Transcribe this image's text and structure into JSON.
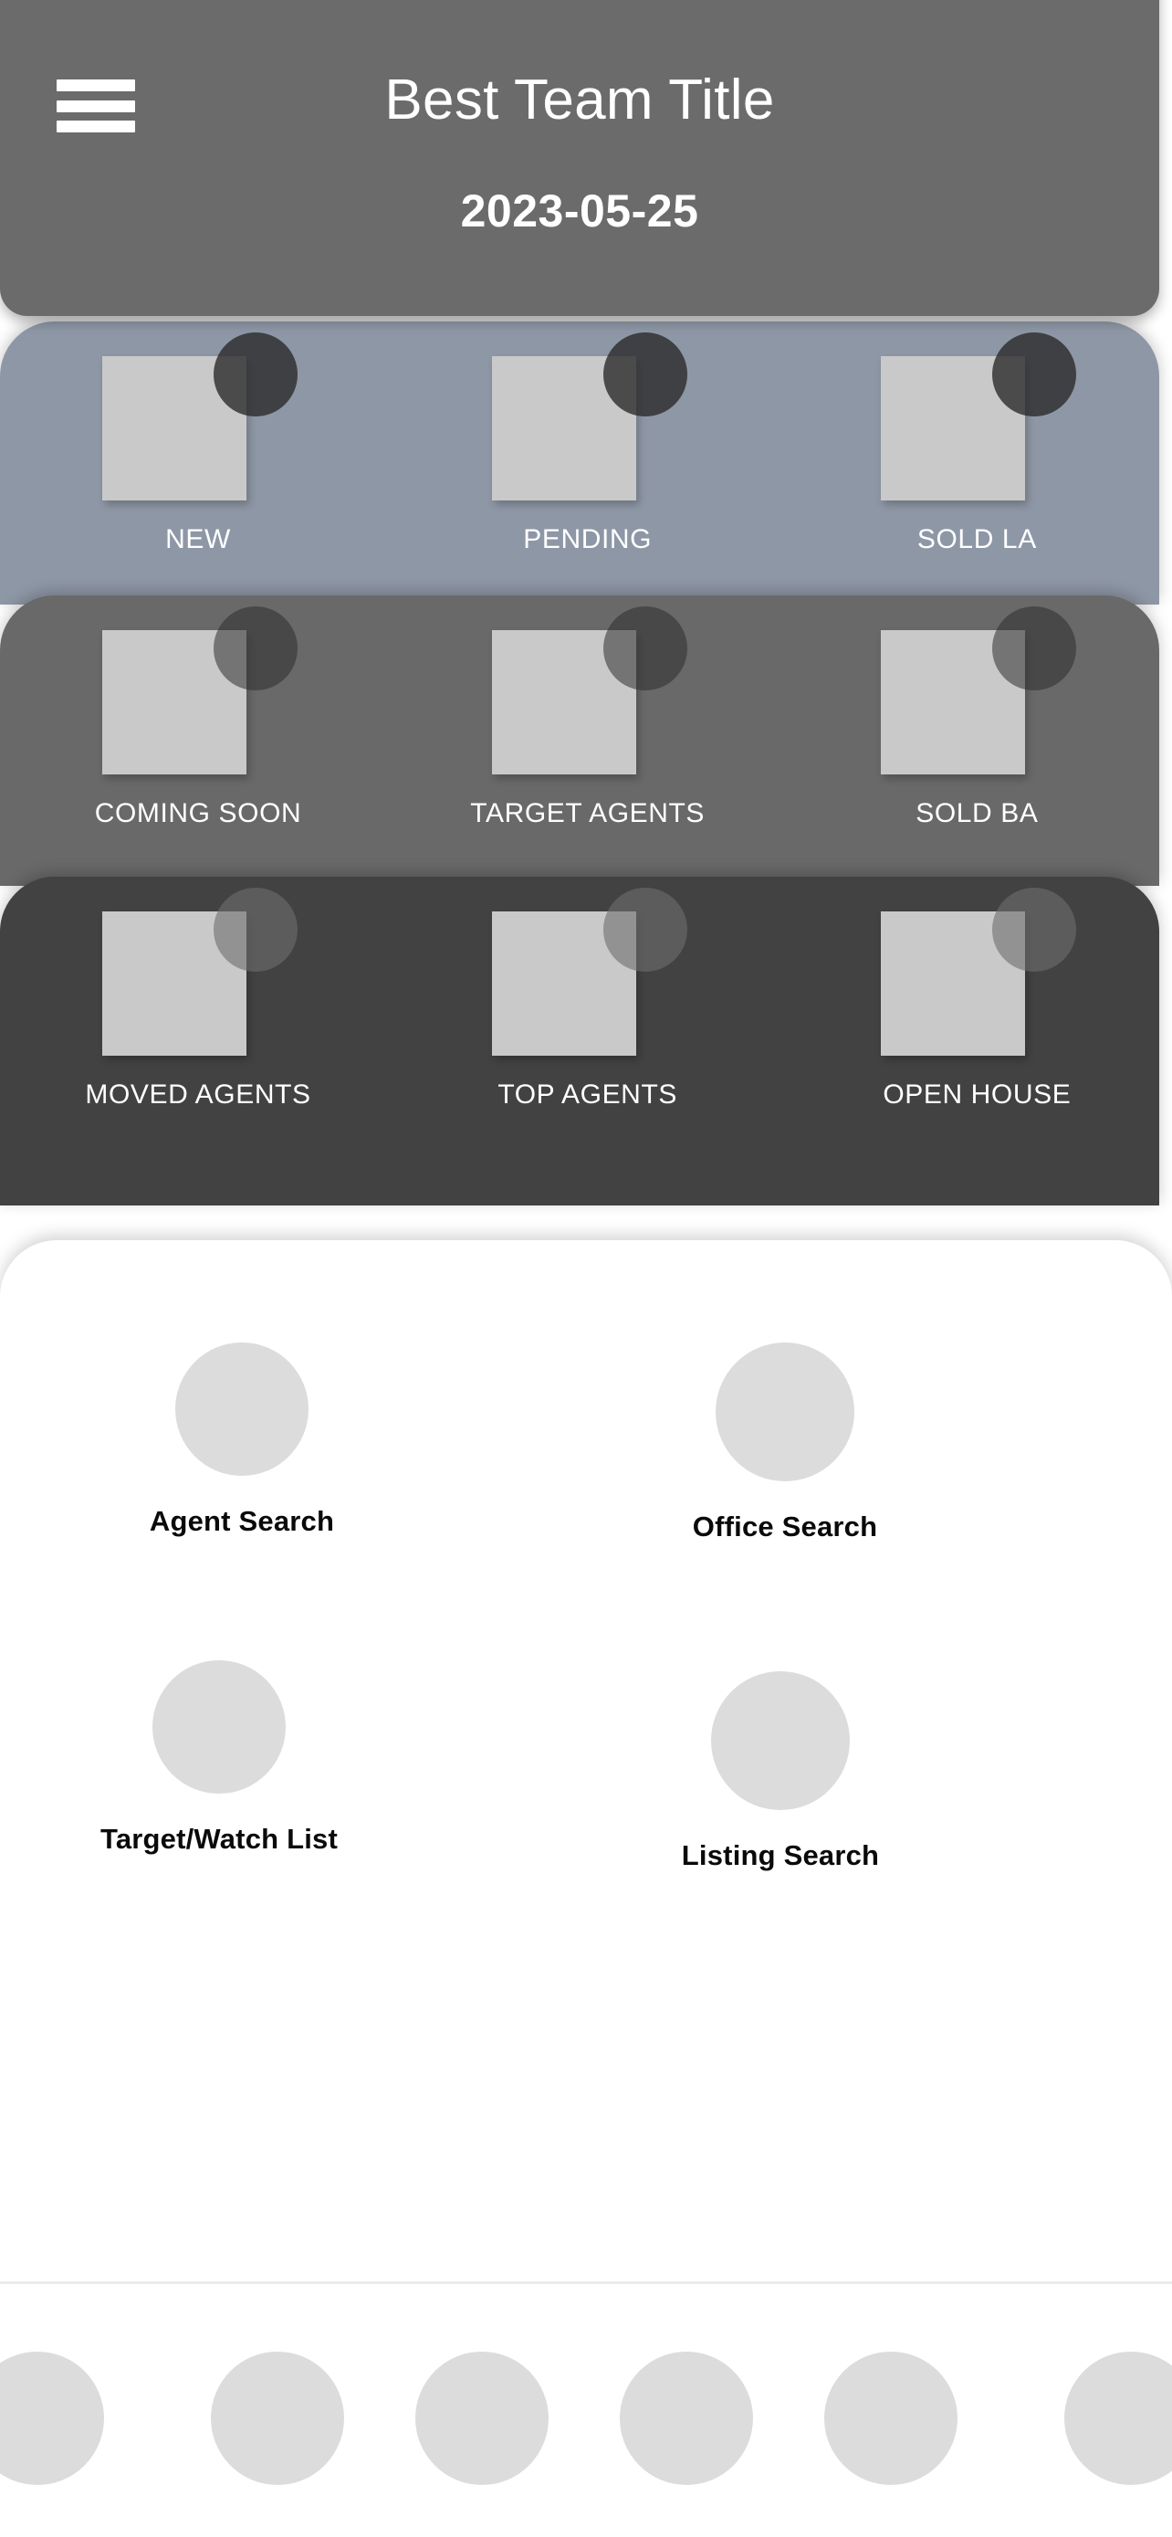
{
  "header": {
    "title": "Best Team Title",
    "date": "2023-05-25",
    "menu_icon": "hamburger-menu-icon",
    "background_color": "#6b6b6b"
  },
  "panels": [
    {
      "background_color": "#8e97a6",
      "tiles": [
        {
          "label": "NEW",
          "thumb_icon": "image-placeholder-icon",
          "badge_icon": "circle-badge-icon"
        },
        {
          "label": "PENDING",
          "thumb_icon": "image-placeholder-icon",
          "badge_icon": "circle-badge-icon"
        },
        {
          "label": "SOLD LA",
          "thumb_icon": "image-placeholder-icon",
          "badge_icon": "circle-badge-icon"
        }
      ]
    },
    {
      "background_color": "#696969",
      "tiles": [
        {
          "label": "COMING SOON",
          "thumb_icon": "image-placeholder-icon",
          "badge_icon": "circle-badge-icon"
        },
        {
          "label": "TARGET AGENTS",
          "thumb_icon": "image-placeholder-icon",
          "badge_icon": "circle-badge-icon"
        },
        {
          "label": "SOLD BA",
          "thumb_icon": "image-placeholder-icon",
          "badge_icon": "circle-badge-icon"
        }
      ]
    },
    {
      "background_color": "#424242",
      "tiles": [
        {
          "label": "MOVED AGENTS",
          "thumb_icon": "image-placeholder-icon",
          "badge_icon": "circle-badge-icon"
        },
        {
          "label": "TOP AGENTS",
          "thumb_icon": "image-placeholder-icon",
          "badge_icon": "circle-badge-icon"
        },
        {
          "label": "OPEN HOUSE",
          "thumb_icon": "image-placeholder-icon",
          "badge_icon": "circle-badge-icon"
        }
      ]
    }
  ],
  "actions": [
    {
      "label": "Agent Search",
      "icon": "agent-search-icon"
    },
    {
      "label": "Office Search",
      "icon": "office-search-icon"
    },
    {
      "label": "Target/Watch List",
      "icon": "target-watch-list-icon"
    },
    {
      "label": "Listing Search",
      "icon": "listing-search-icon"
    }
  ],
  "tabbar": {
    "items": [
      {
        "icon": "tab-icon-1"
      },
      {
        "icon": "tab-icon-2"
      },
      {
        "icon": "tab-icon-3"
      },
      {
        "icon": "tab-icon-4"
      },
      {
        "icon": "tab-icon-5"
      },
      {
        "icon": "tab-icon-6"
      }
    ]
  }
}
